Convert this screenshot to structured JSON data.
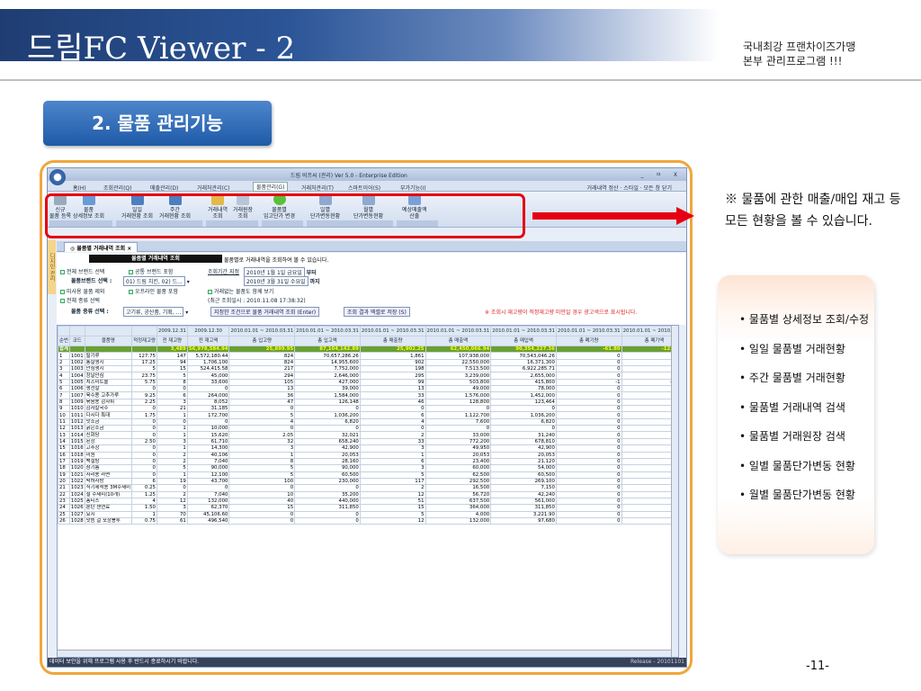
{
  "header": {
    "title": "드림FC Viewer - 2",
    "subtitle1": "국내최강 프랜차이즈가맹",
    "subtitle2": "본부 관리프로그램 !!!"
  },
  "section": {
    "label": "2. 물품 관리기능"
  },
  "app": {
    "titlebar": "드림 비프씨 (관리) Ver 5.0 - Enterprise Edition",
    "controls": "_ ㅁ X",
    "menu": [
      "홈(H)",
      "조회관리(Q)",
      "매출관리(D)",
      "거래처관리(C)",
      "물품관리(G)",
      "거래처관리(T)",
      "스마트이어(S)",
      "부가기능(I)"
    ],
    "menu_right": "거래내역 정산 · 스타일 · 모든 창 닫기",
    "ribbon": [
      {
        "l1": "신규",
        "l2": "물품 등록"
      },
      {
        "l1": "물품",
        "l2": "상세정보 조회"
      },
      {
        "l1": "일일",
        "l2": "거래현황 조회"
      },
      {
        "l1": "주간",
        "l2": "거래현황 조회"
      },
      {
        "l1": "거래내역",
        "l2": "조회"
      },
      {
        "l1": "거래원장",
        "l2": "조회"
      },
      {
        "l1": "물품별",
        "l2": "입고단가 변경"
      },
      {
        "l1": "일별",
        "l2": "단가변동현황"
      },
      {
        "l1": "월별",
        "l2": "단가변동현황"
      },
      {
        "l1": "예상매출액",
        "l2": "산출"
      }
    ],
    "side_tab": "디지인 관리",
    "tab": "물품별 거래내역 조회",
    "filter": {
      "black_label": "물품별 거래내역 조회",
      "hint": "물품별로 거래내역을 조회하여 볼 수 있습니다.",
      "r1a": "전체 브랜드 선택",
      "r1b": "공통 브랜드 포함",
      "period": "조회기간 지정",
      "d1": "2010년 1월 1일 금요일",
      "from": "부터",
      "brand_label": "물품브랜드 선택 :",
      "brand_val": "01) 드림 치킨, 02) 드...",
      "d2": "2010년 3월 31일 수요일",
      "to": "까지",
      "r3a": "미사용 물품 제외",
      "r3b": "오프라인 물품 포함",
      "r3c": "거래없는 물품도 함께 보기",
      "r4a": "전체 종류 선택",
      "last": "(최근 조회일시 : 2010.11.08 17:38:32)",
      "kind_label": "물품 종류 선택 :",
      "kind_val": "고기류, 공산품, 기획, ...",
      "btn1": "지정한 조건으로 물품 거래내역 조회 (Enter)",
      "btn2": "조회 결과 엑셀로 저장 (S)",
      "warn": "※ 조회시 재고량이 적정재고량 미만일 경우 광고색으로 표시됩니다."
    },
    "grid": {
      "date_row": [
        "",
        "",
        "",
        "",
        "2009.12.31",
        "2009.12.30",
        "2010.01.01 ~ 2010.03.31",
        "2010.01.01 ~ 2010.03.31",
        "2010.01.01 ~ 2010.03.31",
        "2010.01.01 ~ 2010.03.31",
        "2010.01.01 ~ 2010.03.31",
        "2010.01.01 ~ 2010.03.31",
        "2010.01.01 ~ 2010.03.31",
        "2010.01.01 ~ 2010.03.31",
        "2010.03.31",
        "2010.03.31",
        "2010"
      ],
      "columns": [
        "순번",
        "코드",
        "물품명",
        "적정재고량",
        "전 재고량",
        "전 재고액",
        "총 입고량",
        "총 입고액",
        "총 매출량",
        "총 매출액",
        "총 매입액",
        "총 폐기량",
        "총 폐기액",
        "현 재고량",
        "현 재고액",
        ""
      ],
      "sum": [
        "합계",
        "",
        "",
        "",
        "3,489",
        "56,978,584.94",
        "25,899.95",
        "87,104,142.89",
        "25,902.25",
        "62,450,066.94",
        "90,354,227.36",
        "-61.80",
        "-123,675",
        "3,892.80",
        "54,853,322.11"
      ],
      "rows": [
        [
          "1",
          "1001",
          "딸기루",
          "127.75",
          "147",
          "5,572,180.44",
          "824",
          "70,657,286.26",
          "1,861",
          "107,938,000",
          "70,543,046.26",
          "0",
          "0",
          "115",
          "4,359,188.78"
        ],
        [
          "2",
          "1002",
          "통살생지",
          "17.25",
          "94",
          "1,706,100",
          "824",
          "14,955,600",
          "902",
          "22,550,000",
          "16,371,300",
          "0",
          "0",
          "34",
          "617,100"
        ],
        [
          "3",
          "1003",
          "안심생지",
          "5",
          "15",
          "524,415.58",
          "217",
          "7,752,000",
          "198",
          "7,513,500",
          "6,922,285.71",
          "0",
          "0",
          "24",
          "839,064.94"
        ],
        [
          "4",
          "1004",
          "장날안심",
          "23.75",
          "5",
          "45,000",
          "294",
          "2,646,000",
          "295",
          "3,239,000",
          "2,655,000",
          "0",
          "0",
          "6",
          "54,000"
        ],
        [
          "5",
          "1005",
          "치즈미트볼",
          "5.75",
          "8",
          "33,600",
          "105",
          "427,000",
          "99",
          "503,800",
          "415,800",
          "-1",
          "-3,900",
          "7",
          "29,400"
        ],
        [
          "6",
          "1006",
          "생선살",
          "0",
          "0",
          "0",
          "13",
          "39,000",
          "13",
          "49,000",
          "78,000",
          "0",
          "0",
          "0",
          "0"
        ],
        [
          "7",
          "1007",
          "육수용 고추가루",
          "9.25",
          "6",
          "264,000",
          "36",
          "1,584,000",
          "33",
          "1,576,000",
          "1,452,000",
          "0",
          "0",
          "7",
          "308,000"
        ],
        [
          "8",
          "1009",
          "볶음용 감자튀",
          "2.25",
          "3",
          "8,052",
          "47",
          "126,148",
          "46",
          "128,800",
          "123,464",
          "0",
          "0",
          "4",
          "10,736"
        ],
        [
          "9",
          "1010",
          "감자칼국수",
          "0",
          "21",
          "31,185",
          "0",
          "0",
          "0",
          "0",
          "0",
          "0",
          "0",
          "21",
          "31,185"
        ],
        [
          "10",
          "1011",
          "다시다 특대",
          "1.75",
          "1",
          "172,700",
          "5",
          "1,036,200",
          "6",
          "1,122,700",
          "1,036,200",
          "0",
          "0",
          "4",
          "172,700"
        ],
        [
          "11",
          "1012",
          "맛소금",
          "0",
          "0",
          "0",
          "4",
          "6,820",
          "4",
          "7,600",
          "6,820",
          "0",
          "0",
          "1",
          "1,705"
        ],
        [
          "12",
          "1013",
          "굵은소금",
          "0",
          "1",
          "10,000",
          "0",
          "0",
          "0",
          "0",
          "0",
          "0",
          "0",
          "1",
          "10,000"
        ],
        [
          "13",
          "1014",
          "신화당",
          "0",
          "1",
          "15,620",
          "2.05",
          "32,021",
          "2",
          "33,000",
          "31,240",
          "0",
          "0",
          "1.05",
          "16,401"
        ],
        [
          "14",
          "1015",
          "된장",
          "2.50",
          "3",
          "61,710",
          "32",
          "658,240",
          "33",
          "772,200",
          "678,810",
          "0",
          "0",
          "2",
          "41,140"
        ],
        [
          "15",
          "1016",
          "고추장",
          "0",
          "1",
          "14,300",
          "3",
          "42,900",
          "3",
          "49,950",
          "42,900",
          "0",
          "0",
          "1",
          "14,300"
        ],
        [
          "16",
          "1018",
          "미원",
          "0",
          "2",
          "40,106",
          "1",
          "20,053",
          "1",
          "20,053",
          "20,053",
          "0",
          "0",
          "2",
          "20,053"
        ],
        [
          "17",
          "1019",
          "백설탕",
          "0",
          "2",
          "7,040",
          "8",
          "28,160",
          "6",
          "23,400",
          "21,120",
          "0",
          "0",
          "4",
          "14,080"
        ],
        [
          "18",
          "1020",
          "참기름",
          "0",
          "5",
          "90,000",
          "5",
          "90,000",
          "3",
          "60,000",
          "54,000",
          "0",
          "0",
          "4",
          "72,000"
        ],
        [
          "19",
          "1021",
          "사리용 라면",
          "0",
          "1",
          "12,100",
          "5",
          "60,500",
          "5",
          "62,500",
          "60,500",
          "0",
          "0",
          "1",
          "12,100"
        ],
        [
          "20",
          "1022",
          "떡하사랑",
          "6",
          "19",
          "43,700",
          "100",
          "230,000",
          "117",
          "292,500",
          "269,100",
          "0",
          "0",
          "19",
          "43,700"
        ],
        [
          "21",
          "1023",
          "식기세척용 3M수세미",
          "0.25",
          "0",
          "0",
          "0",
          "0",
          "2",
          "16,500",
          "7,150",
          "0",
          "0",
          "4",
          "14,300"
        ],
        [
          "22",
          "1024",
          "철 수세미(10개)",
          "1.25",
          "2",
          "7,040",
          "10",
          "35,200",
          "12",
          "56,720",
          "42,240",
          "0",
          "0",
          "4",
          "14,080"
        ],
        [
          "23",
          "1025",
          "퐁티스",
          "4",
          "12",
          "132,000",
          "40",
          "440,000",
          "51",
          "637,500",
          "561,000",
          "0",
          "0",
          "10",
          "110,000"
        ],
        [
          "24",
          "1026",
          "분탄 센연료",
          "1.50",
          "3",
          "62,370",
          "15",
          "311,850",
          "15",
          "364,000",
          "311,850",
          "0",
          "0",
          "2",
          "41,580"
        ],
        [
          "25",
          "1027",
          "요지",
          "1",
          "70",
          "45,106.60",
          "0",
          "0",
          "5",
          "4,000",
          "3,221.90",
          "0",
          "0",
          "39",
          "25,130.82"
        ],
        [
          "26",
          "1028",
          "맛뜸 걸 포장봉투",
          "0.75",
          "61",
          "496,540",
          "0",
          "0",
          "12",
          "132,000",
          "97,680",
          "0",
          "0",
          "22",
          "179,080"
        ]
      ]
    },
    "status": "데이터 보안을 위해 프로그램 사용 후 반드시 종료하시기 바랍니다.",
    "release": "Release - 20101101"
  },
  "note": "※ 물품에 관한 매출/매입 재고 등 모든 현황을 볼 수 있습니다.",
  "features": [
    "물품별 상세정보 조회/수정",
    "일일 물품별 거래현황",
    "주간 물품별 거래현황",
    "물품별 거래내역 검색",
    "물품별 거래원장 검색",
    "일별 물품단가변동 현황",
    "월별 물품단가변동 현황"
  ],
  "page_number": "-11-",
  "colors": {
    "accent_orange": "#f0a63c",
    "highlight_red": "#e60012",
    "header_blue": "#2b5597",
    "total_green": "#6aa032"
  }
}
